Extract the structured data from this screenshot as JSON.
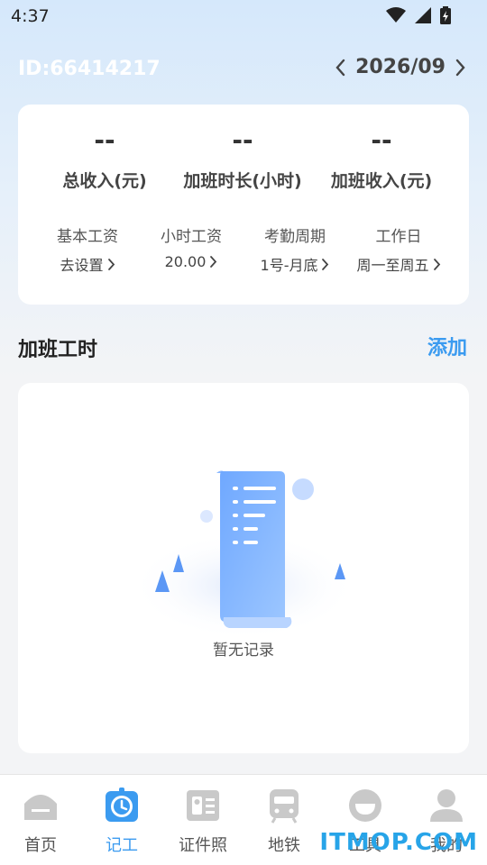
{
  "status_bar": {
    "time": "4:37"
  },
  "header": {
    "user_id": "ID:66414217",
    "month": "2026/09"
  },
  "summary": {
    "stats": [
      {
        "value": "--",
        "label": "总收入(元)"
      },
      {
        "value": "--",
        "label": "加班时长(小时)"
      },
      {
        "value": "--",
        "label": "加班收入(元)"
      }
    ],
    "settings": [
      {
        "label": "基本工资",
        "value": "去设置"
      },
      {
        "label": "小时工资",
        "value": "20.00"
      },
      {
        "label": "考勤周期",
        "value": "1号-月底"
      },
      {
        "label": "工作日",
        "value": "周一至周五"
      }
    ]
  },
  "overtime": {
    "title": "加班工时",
    "add_label": "添加",
    "empty_text": "暂无记录"
  },
  "tabbar": {
    "active_color": "#3b9bf0",
    "items": [
      {
        "label": "首页",
        "icon": "home-icon"
      },
      {
        "label": "记工",
        "icon": "clock-icon"
      },
      {
        "label": "证件照",
        "icon": "id-card-icon"
      },
      {
        "label": "地铁",
        "icon": "metro-icon"
      },
      {
        "label": "工具",
        "icon": "face-icon"
      },
      {
        "label": "我的",
        "icon": "user-icon"
      }
    ]
  },
  "watermark": "ITMOP.COM"
}
